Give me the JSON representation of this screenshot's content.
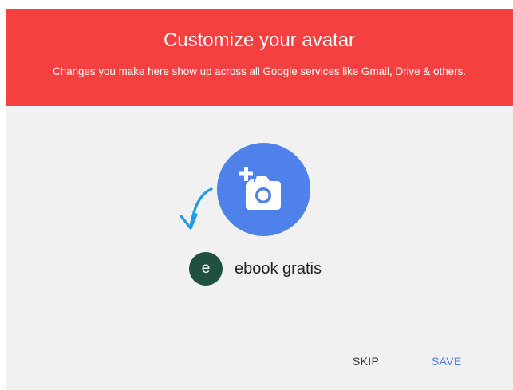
{
  "header": {
    "title": "Customize your avatar",
    "subtitle": "Changes you make here show up across all Google services like Gmail, Drive & others."
  },
  "photo": {
    "icon": "add-photo-camera-icon",
    "color": "#4e81ea"
  },
  "hint_arrow": {
    "icon": "curved-arrow-icon",
    "color": "#1e9be6"
  },
  "account": {
    "initial": "e",
    "name": "ebook gratis",
    "avatar_color": "#1f5040"
  },
  "actions": {
    "skip_label": "SKIP",
    "save_label": "SAVE"
  },
  "colors": {
    "header_bg": "#f44040",
    "body_bg": "#f1f1f1",
    "accent": "#4e81ea"
  }
}
